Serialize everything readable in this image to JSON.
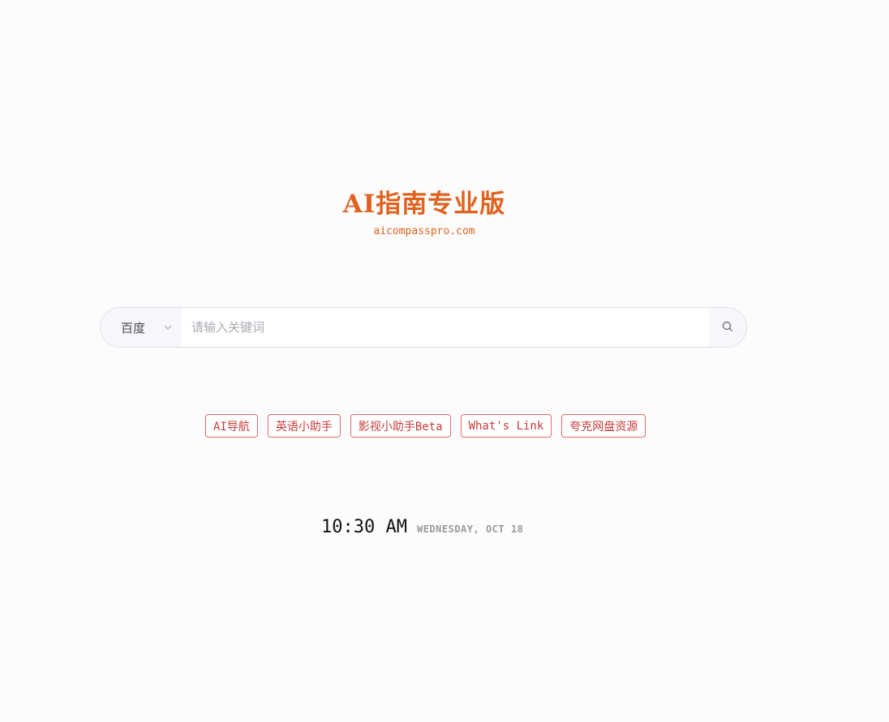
{
  "brand": {
    "title": "AI指南专业版",
    "url": "aicompasspro.com",
    "accent_color": "#e0621f"
  },
  "search": {
    "engine": "百度",
    "engine_icon": "chevron-down-icon",
    "placeholder": "请输入关键词",
    "value": "",
    "button_icon": "search-icon"
  },
  "quick_links": [
    {
      "label": "AI导航"
    },
    {
      "label": "英语小助手"
    },
    {
      "label": "影视小助手Beta"
    },
    {
      "label": "What's Link"
    },
    {
      "label": "夸克网盘资源"
    }
  ],
  "clock": {
    "time": "10:30 AM",
    "date": "WEDNESDAY, OCT 18"
  },
  "colors": {
    "link_border": "#e46a6a",
    "link_text": "#c83b3b",
    "background": "#fcfcfc"
  }
}
